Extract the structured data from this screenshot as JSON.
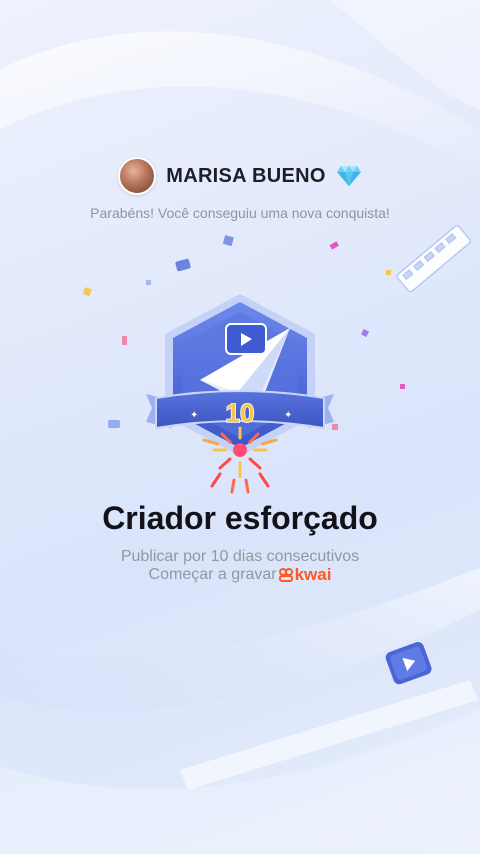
{
  "user": {
    "name": "MARISA BUENO",
    "badge_icon": "diamond-icon"
  },
  "congrats_text": "Parabéns! Você conseguiu uma nova conquista!",
  "achievement": {
    "number": "10",
    "title": "Criador esforçado",
    "description": "Publicar por 10 dias consecutivos",
    "cta": "Começar a gravar",
    "brand": "kwai"
  },
  "colors": {
    "badge": "#4a66d6",
    "accent": "#ff5a1f",
    "title": "#121218",
    "subtle": "#9496a2"
  }
}
